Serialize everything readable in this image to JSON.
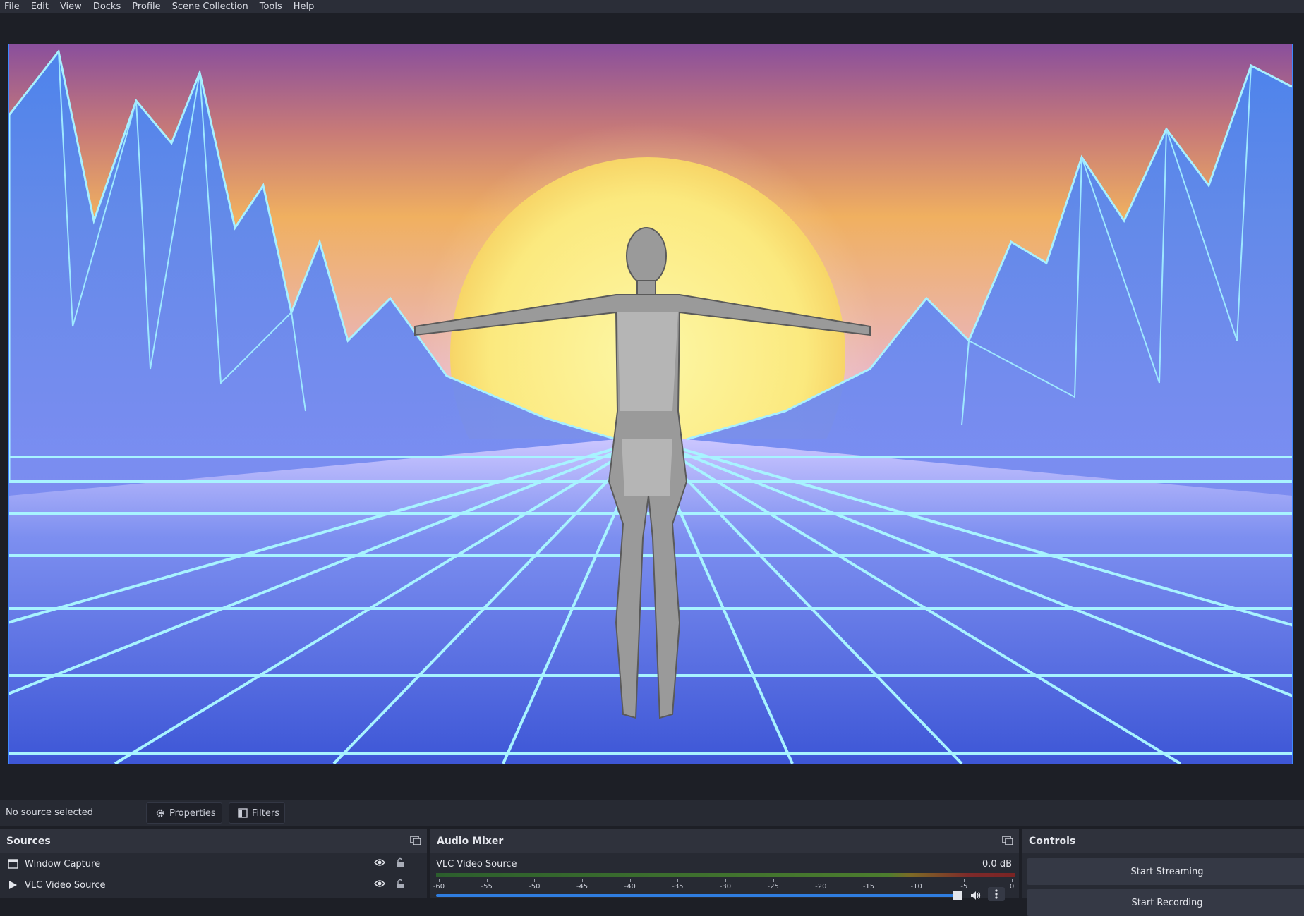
{
  "menu": [
    "File",
    "Edit",
    "View",
    "Docks",
    "Profile",
    "Scene Collection",
    "Tools",
    "Help"
  ],
  "source_toolbar": {
    "status": "No source selected",
    "properties_label": "Properties",
    "filters_label": "Filters"
  },
  "sources": {
    "title": "Sources",
    "items": [
      {
        "label": "Window Capture",
        "icon": "window-icon",
        "visible": true,
        "locked": false
      },
      {
        "label": "VLC Video Source",
        "icon": "play-icon",
        "visible": true,
        "locked": false
      }
    ]
  },
  "audio_mixer": {
    "title": "Audio Mixer",
    "channel": "VLC Video Source",
    "level": "0.0 dB",
    "ticks": [
      "-60",
      "-55",
      "-50",
      "-45",
      "-40",
      "-35",
      "-30",
      "-25",
      "-20",
      "-15",
      "-10",
      "-5",
      "0"
    ],
    "volume_fraction": 1.0
  },
  "controls": {
    "title": "Controls",
    "buttons": [
      "Start Streaming",
      "Start Recording"
    ]
  },
  "colors": {
    "accent": "#3e88ff",
    "window_bg": "#1d1f26",
    "panel_bg": "#272a33"
  }
}
